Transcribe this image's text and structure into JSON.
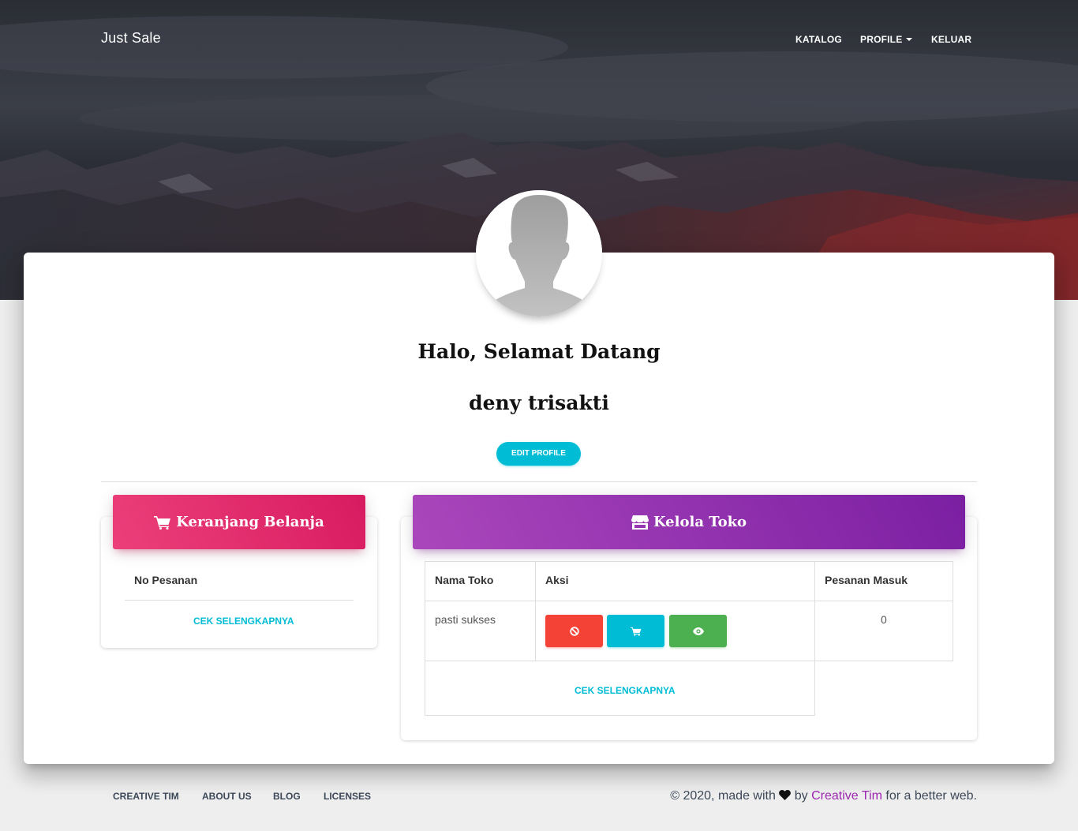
{
  "navbar": {
    "brand": "Just Sale",
    "items": [
      {
        "label": "KATALOG"
      },
      {
        "label": "PROFILE"
      },
      {
        "label": "KELUAR"
      }
    ]
  },
  "profile": {
    "greeting": "Halo, Selamat Datang",
    "name": "deny trisakti",
    "edit_button": "EDIT PROFILE"
  },
  "cart_card": {
    "title": "Keranjang Belanja",
    "column_header": "No Pesanan",
    "more_link": "CEK SELENGKAPNYA"
  },
  "store_card": {
    "title": "Kelola Toko",
    "columns": [
      "Nama Toko",
      "Aksi",
      "Pesanan Masuk"
    ],
    "rows": [
      {
        "store_name": "pasti sukses",
        "incoming_orders": "0"
      }
    ],
    "more_link": "CEK SELENGKAPNYA"
  },
  "footer": {
    "links": [
      "CREATIVE TIM",
      "ABOUT US",
      "BLOG",
      "LICENSES"
    ],
    "copyright_prefix": "© 2020, made with",
    "copyright_by": "by",
    "copyright_author": "Creative Tim",
    "copyright_suffix": "for a better web."
  },
  "colors": {
    "accent_cyan": "#00bcd4",
    "cart_header": "#e91e63",
    "store_header": "#9c27b0",
    "danger": "#f44336",
    "success": "#4caf50"
  },
  "icons": {
    "cart_title": "shopping-cart-icon",
    "store_title": "store-icon",
    "action_disable": "ban-icon",
    "action_cart": "shopping-cart-icon",
    "action_view": "eye-icon",
    "footer_heart": "heart-icon"
  }
}
